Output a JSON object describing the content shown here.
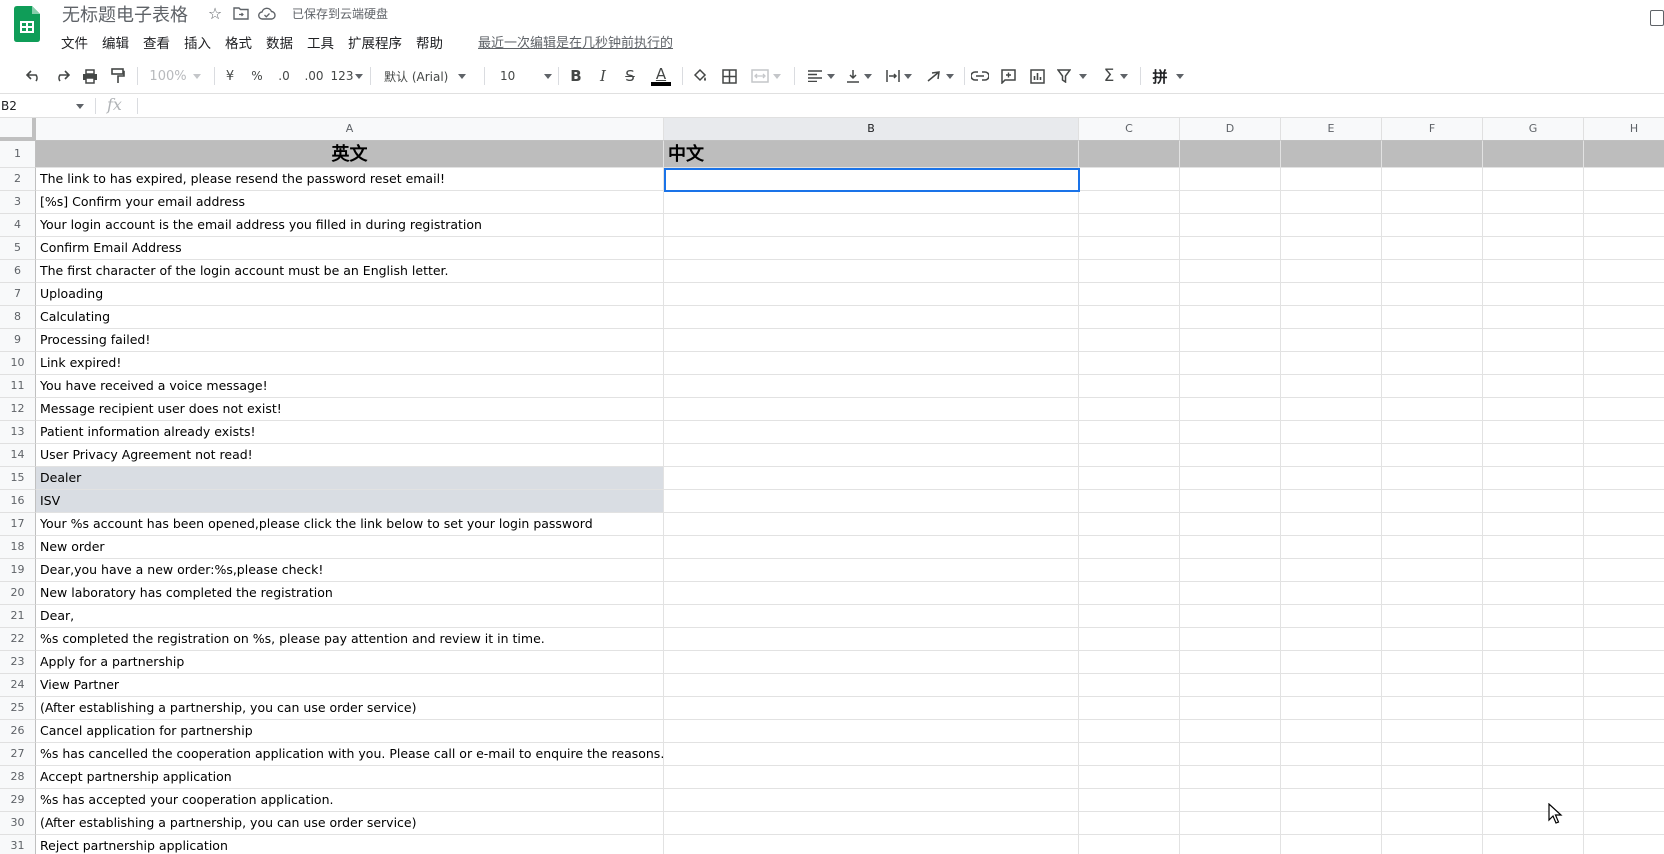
{
  "header": {
    "doc_title": "无标题电子表格",
    "save_status": "已保存到云端硬盘",
    "last_edit": "最近一次编辑是在几秒钟前执行的",
    "menu": [
      "文件",
      "编辑",
      "查看",
      "插入",
      "格式",
      "数据",
      "工具",
      "扩展程序",
      "帮助"
    ]
  },
  "toolbar": {
    "zoom": "100%",
    "currency": "¥",
    "percent": "%",
    "decrease_decimal": ".0",
    "increase_decimal": ".00",
    "number_format": "123",
    "font": "默认 (Arial)",
    "font_size": "10",
    "bold": "B",
    "italic": "I",
    "strikethrough": "S",
    "text_color": "A",
    "input_tools": "拼"
  },
  "formula_bar": {
    "name_box": "B2",
    "fx": "fx"
  },
  "columns": [
    "A",
    "B",
    "C",
    "D",
    "E",
    "F",
    "G",
    "H"
  ],
  "selected_cell": "B2",
  "rows": [
    {
      "num": "1",
      "a": "英文",
      "b": "中文"
    },
    {
      "num": "2",
      "a": "The link to has expired, please resend the password reset email!",
      "b": ""
    },
    {
      "num": "3",
      "a": "[%s] Confirm your email address",
      "b": ""
    },
    {
      "num": "4",
      "a": "Your login account is the email address you filled in during registration",
      "b": ""
    },
    {
      "num": "5",
      "a": "Confirm Email Address",
      "b": ""
    },
    {
      "num": "6",
      "a": "The first character of the login account must be an English letter.",
      "b": ""
    },
    {
      "num": "7",
      "a": "Uploading",
      "b": ""
    },
    {
      "num": "8",
      "a": "Calculating",
      "b": ""
    },
    {
      "num": "9",
      "a": "Processing failed!",
      "b": ""
    },
    {
      "num": "10",
      "a": "Link expired!",
      "b": ""
    },
    {
      "num": "11",
      "a": "You have received a voice message!",
      "b": ""
    },
    {
      "num": "12",
      "a": "Message recipient user does not exist!",
      "b": ""
    },
    {
      "num": "13",
      "a": "Patient information already exists!",
      "b": ""
    },
    {
      "num": "14",
      "a": "User Privacy Agreement not read!",
      "b": ""
    },
    {
      "num": "15",
      "a": "Dealer",
      "b": ""
    },
    {
      "num": "16",
      "a": "ISV",
      "b": ""
    },
    {
      "num": "17",
      "a": "Your %s account has been opened,please click the link below to set your login password",
      "b": ""
    },
    {
      "num": "18",
      "a": "New order",
      "b": ""
    },
    {
      "num": "19",
      "a": "Dear,you have a new order:%s,please check!",
      "b": ""
    },
    {
      "num": "20",
      "a": "New laboratory has completed the registration",
      "b": ""
    },
    {
      "num": "21",
      "a": "Dear,",
      "b": ""
    },
    {
      "num": "22",
      "a": "%s completed the registration on %s, please pay attention and review it in time.",
      "b": ""
    },
    {
      "num": "23",
      "a": "Apply for a partnership",
      "b": ""
    },
    {
      "num": "24",
      "a": "View Partner",
      "b": ""
    },
    {
      "num": "25",
      "a": "(After establishing a partnership, you can use order service)",
      "b": ""
    },
    {
      "num": "26",
      "a": "Cancel application for partnership",
      "b": ""
    },
    {
      "num": "27",
      "a": "%s has cancelled the cooperation application with you. Please call or e-mail to enquire the reasons.",
      "b": ""
    },
    {
      "num": "28",
      "a": "Accept partnership application",
      "b": ""
    },
    {
      "num": "29",
      "a": "%s has accepted your cooperation application.",
      "b": ""
    },
    {
      "num": "30",
      "a": "(After establishing a partnership, you can use order service)",
      "b": ""
    },
    {
      "num": "31",
      "a": "Reject partnership application",
      "b": ""
    }
  ],
  "colors": {
    "accent": "#1a73e8",
    "header_fill": "#bdbdbd",
    "highlight_fill": "#d9dde3",
    "sheets_green": "#0f9d58"
  }
}
